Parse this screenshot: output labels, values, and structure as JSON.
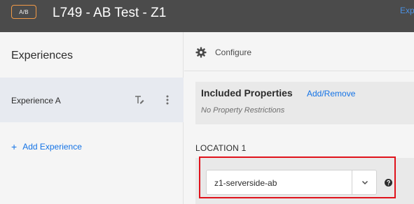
{
  "header": {
    "badge": "A/B",
    "title": "L749 - AB Test - Z1",
    "link": "Exp"
  },
  "sidebar": {
    "title": "Experiences",
    "experience": {
      "label": "Experience A"
    },
    "add_label": "Add Experience",
    "add_icon": "+"
  },
  "main": {
    "configure_label": "Configure",
    "included_properties": {
      "title": "Included Properties",
      "link": "Add/Remove",
      "note": "No Property Restrictions"
    },
    "location": {
      "label": "LOCATION 1",
      "value": "z1-serverside-ab"
    }
  },
  "colors": {
    "topbar": "#4b4b4b",
    "badge_border": "#f19a47",
    "link": "#1473e6",
    "highlight": "#e0121b",
    "selected_row": "#e7eaf0"
  }
}
